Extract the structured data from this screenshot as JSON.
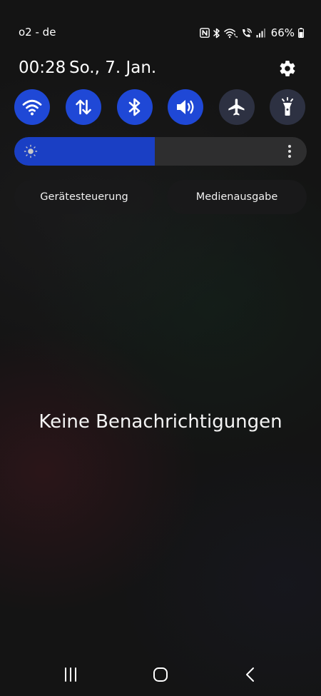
{
  "status_bar": {
    "carrier": "o2 - de",
    "battery_percent": "66%",
    "battery_level": 0.66,
    "icons": [
      "nfc-icon",
      "bluetooth-icon",
      "wifi-calling-icon",
      "volte-call-icon",
      "signal-icon",
      "battery-icon"
    ]
  },
  "header": {
    "time": "00:28",
    "date": "So., 7. Jan.",
    "settings_icon": "gear-icon"
  },
  "quick_toggles": [
    {
      "name": "wifi",
      "icon": "wifi-icon",
      "active": true
    },
    {
      "name": "mobile-data",
      "icon": "mobile-data-icon",
      "active": true
    },
    {
      "name": "bluetooth",
      "icon": "bluetooth-icon",
      "active": true
    },
    {
      "name": "sound",
      "icon": "sound-icon",
      "active": true
    },
    {
      "name": "airplane-mode",
      "icon": "airplane-icon",
      "active": false
    },
    {
      "name": "flashlight",
      "icon": "flashlight-icon",
      "active": false
    }
  ],
  "brightness": {
    "level": 0.48,
    "icon": "brightness-icon",
    "more_icon": "more-vertical-icon"
  },
  "controls": {
    "device_control_label": "Gerätesteuerung",
    "media_output_label": "Medienausgabe"
  },
  "notifications": {
    "empty_text": "Keine Benachrichtigungen"
  },
  "navigation": {
    "items": [
      "recents-icon",
      "home-icon",
      "back-icon"
    ]
  },
  "colors": {
    "toggle_active": "#1f48d6",
    "toggle_inactive": "#2d3142",
    "brightness_fill": "#1a3fc4",
    "background": "#141414"
  }
}
